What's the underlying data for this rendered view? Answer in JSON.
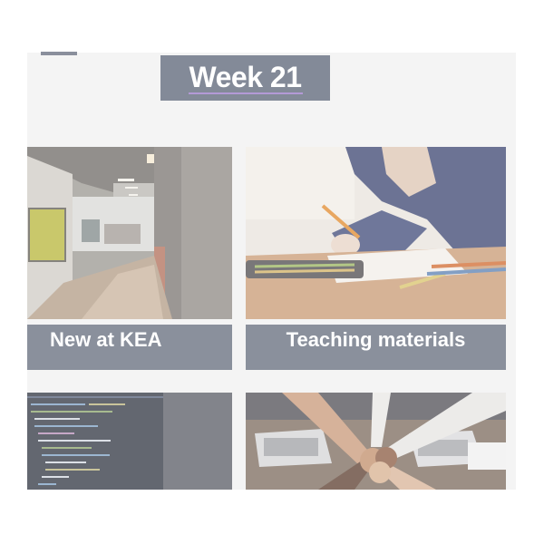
{
  "header": {
    "week_title": "Week 21"
  },
  "cards": [
    {
      "label": "New at KEA",
      "image": "office-hallway-photo"
    },
    {
      "label": "Teaching materials",
      "image": "student-drawing-photo"
    },
    {
      "label": "",
      "image": "code-screen-photo"
    },
    {
      "label": "",
      "image": "teamwork-hands-photo"
    }
  ],
  "colors": {
    "panel_bg": "#f4f4f4",
    "header_bg": "#838a98",
    "label_bg": "#8a909c",
    "title_underline": "#b39ad6"
  }
}
